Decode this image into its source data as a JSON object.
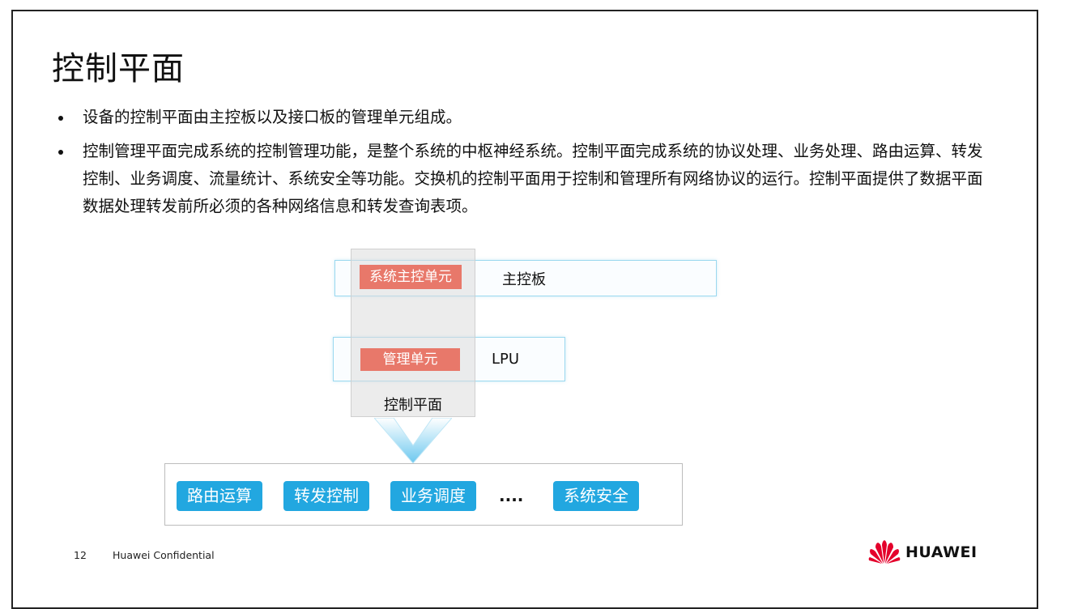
{
  "slide": {
    "title": "控制平面",
    "bullets": [
      "设备的控制平面由主控板以及接口板的管理单元组成。",
      "控制管理平面完成系统的控制管理功能，是整个系统的中枢神经系统。控制平面完成系统的协议处理、业务处理、路由运算、转发控制、业务调度、流量统计、系统安全等功能。交换机的控制平面用于控制和管理所有网络协议的运行。控制平面提供了数据平面数据处理转发前所必须的各种网络信息和转发查询表项。"
    ]
  },
  "diagram": {
    "main_board": {
      "unit": "系统主控单元",
      "label": "主控板"
    },
    "lpu": {
      "unit": "管理单元",
      "label": "LPU"
    },
    "control_plane_label": "控制平面",
    "functions": [
      "路由运算",
      "转发控制",
      "业务调度",
      "系统安全"
    ],
    "ellipsis": "....",
    "colors": {
      "unit_fill": "#e8786a",
      "function_fill": "#22a7e0",
      "band_border": "#9ad8ef",
      "arrow": "#7fd0f0"
    }
  },
  "footer": {
    "page_number": "12",
    "confidentiality": "Huawei Confidential",
    "brand": "HUAWEI",
    "logo_icon": "huawei-petal-logo"
  }
}
